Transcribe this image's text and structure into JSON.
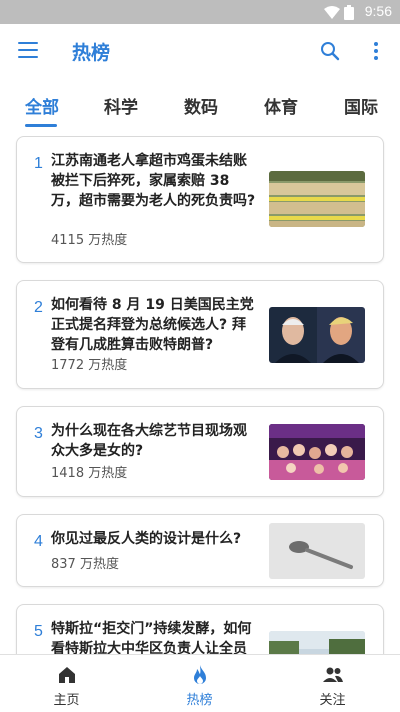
{
  "status_bar": {
    "time": "9:56"
  },
  "app_bar": {
    "title": "热榜"
  },
  "tabs": [
    {
      "label": "全部",
      "active": true
    },
    {
      "label": "科学",
      "active": false
    },
    {
      "label": "数码",
      "active": false
    },
    {
      "label": "体育",
      "active": false
    },
    {
      "label": "国际",
      "active": false
    }
  ],
  "items": [
    {
      "rank": "1",
      "title": "江苏南通老人拿超市鸡蛋未结账被拦下后猝死，家属索赔 38 万，超市需要为老人的死负责吗?",
      "heat": "4115 万热度",
      "thumb": "eggs-shelf-image"
    },
    {
      "rank": "2",
      "title": "如何看待 8 月 19 日美国民主党正式提名拜登为总统候选人? 拜登有几成胜算击败特朗普?",
      "heat": "1772 万热度",
      "thumb": "two-portraits-image"
    },
    {
      "rank": "3",
      "title": "为什么现在各大综艺节目现场观众大多是女的?",
      "heat": "1418 万热度",
      "thumb": "audience-image"
    },
    {
      "rank": "4",
      "title": "你见过最反人类的设计是什么?",
      "heat": "837 万热度",
      "thumb": "spoon-image"
    },
    {
      "rank": "5",
      "title": "特斯拉“拒交门”持续发酵，如何看特斯拉大中华区负责人让全员",
      "heat": "",
      "thumb": "outdoor-image"
    }
  ],
  "bottom_nav": [
    {
      "label": "主页",
      "icon": "home-icon",
      "active": false
    },
    {
      "label": "热榜",
      "icon": "flame-icon",
      "active": true
    },
    {
      "label": "关注",
      "icon": "people-icon",
      "active": false
    }
  ],
  "colors": {
    "accent": "#2f7fd8",
    "text": "#222222",
    "subtext": "#555555",
    "status_bar": "#bdbdbd"
  }
}
